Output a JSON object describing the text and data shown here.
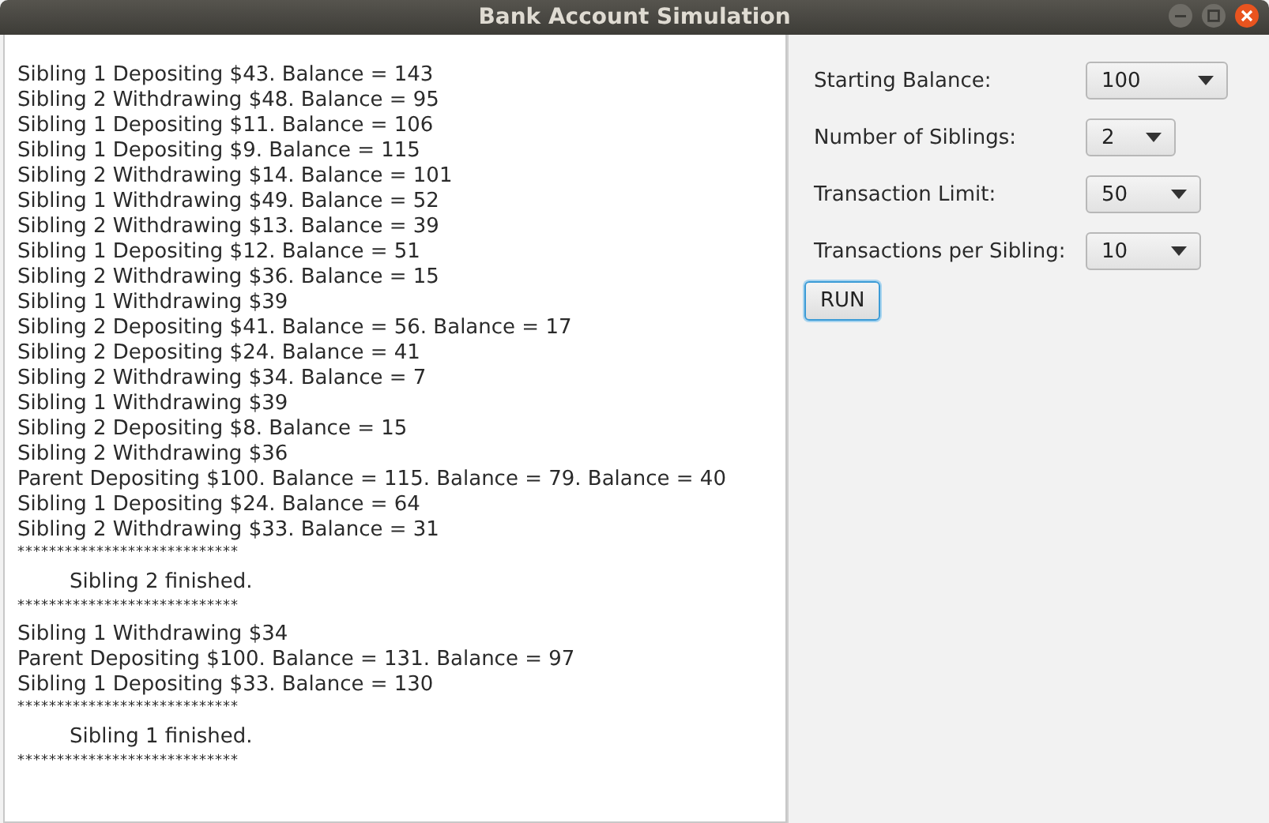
{
  "window": {
    "title": "Bank Account Simulation"
  },
  "log": [
    {
      "kind": "line",
      "text": "Sibling 1 Depositing $43. Balance = 143"
    },
    {
      "kind": "line",
      "text": "Sibling 2 Withdrawing $48. Balance = 95"
    },
    {
      "kind": "line",
      "text": "Sibling 1 Depositing $11. Balance = 106"
    },
    {
      "kind": "line",
      "text": "Sibling 1 Depositing $9. Balance = 115"
    },
    {
      "kind": "line",
      "text": "Sibling 2 Withdrawing $14. Balance = 101"
    },
    {
      "kind": "line",
      "text": "Sibling 1 Withdrawing $49. Balance = 52"
    },
    {
      "kind": "line",
      "text": "Sibling 2 Withdrawing $13. Balance = 39"
    },
    {
      "kind": "line",
      "text": "Sibling 1 Depositing $12. Balance = 51"
    },
    {
      "kind": "line",
      "text": "Sibling 2 Withdrawing $36. Balance = 15"
    },
    {
      "kind": "line",
      "text": "Sibling 1 Withdrawing $39"
    },
    {
      "kind": "line",
      "text": "Sibling 2 Depositing $41. Balance = 56. Balance = 17"
    },
    {
      "kind": "line",
      "text": "Sibling 2 Depositing $24. Balance = 41"
    },
    {
      "kind": "line",
      "text": "Sibling 2 Withdrawing $34. Balance = 7"
    },
    {
      "kind": "line",
      "text": "Sibling 1 Withdrawing $39"
    },
    {
      "kind": "line",
      "text": "Sibling 2 Depositing $8. Balance = 15"
    },
    {
      "kind": "line",
      "text": "Sibling 2 Withdrawing $36"
    },
    {
      "kind": "line",
      "text": "Parent Depositing $100. Balance = 115. Balance = 79. Balance = 40"
    },
    {
      "kind": "line",
      "text": "Sibling 1 Depositing $24. Balance = 64"
    },
    {
      "kind": "line",
      "text": "Sibling 2 Withdrawing $33. Balance = 31"
    },
    {
      "kind": "separator",
      "text": "****************************"
    },
    {
      "kind": "indented",
      "text": "Sibling 2 finished."
    },
    {
      "kind": "separator",
      "text": "****************************"
    },
    {
      "kind": "line",
      "text": "Sibling 1 Withdrawing $34"
    },
    {
      "kind": "line",
      "text": "Parent Depositing $100. Balance = 131. Balance = 97"
    },
    {
      "kind": "line",
      "text": "Sibling 1 Depositing $33. Balance = 130"
    },
    {
      "kind": "separator",
      "text": "****************************"
    },
    {
      "kind": "indented",
      "text": "Sibling 1 finished."
    },
    {
      "kind": "separator",
      "text": "****************************"
    }
  ],
  "settings": [
    {
      "label": "Starting Balance:",
      "value": "100"
    },
    {
      "label": "Number of Siblings:",
      "value": "2"
    },
    {
      "label": "Transaction Limit:",
      "value": "50"
    },
    {
      "label": "Transactions per Sibling:",
      "value": "10"
    }
  ],
  "run_button": {
    "label": "RUN"
  }
}
